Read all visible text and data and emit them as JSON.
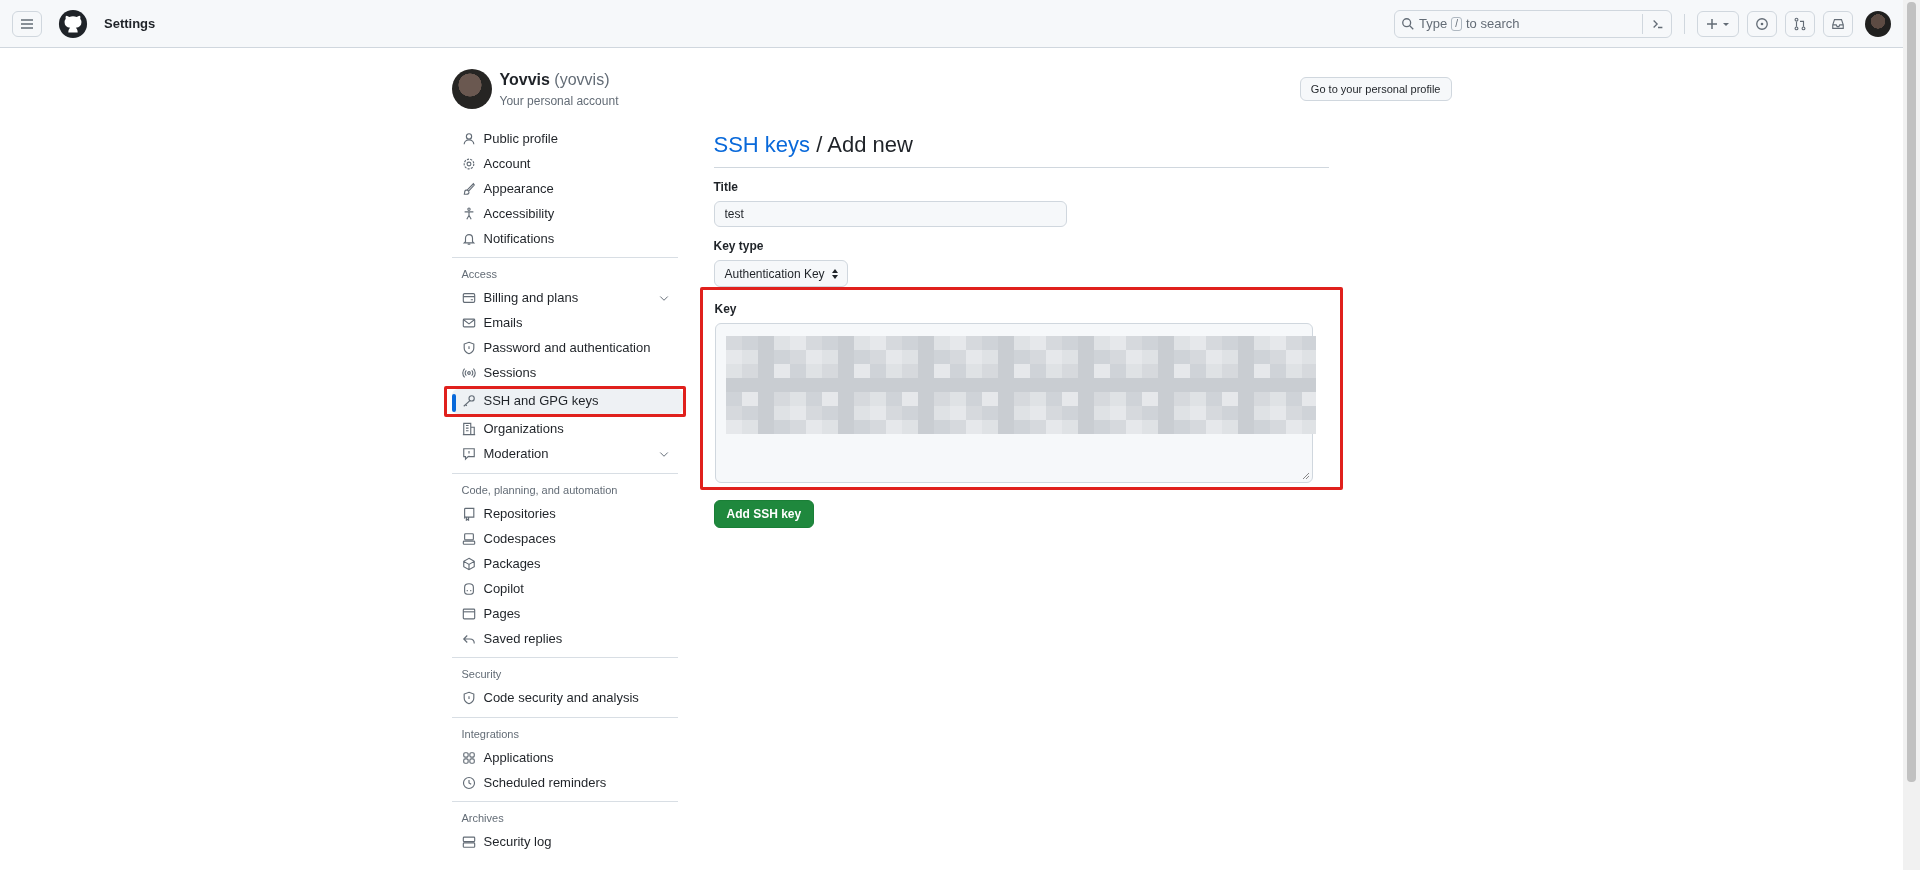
{
  "header": {
    "title": "Settings",
    "search": {
      "before": "Type",
      "key": "/",
      "after": "to search"
    }
  },
  "account": {
    "name": "Yovvis",
    "handle": "(yovvis)",
    "subtitle": "Your personal account",
    "profile_button": "Go to your personal profile"
  },
  "sidebar": {
    "sections": [
      {
        "items": [
          {
            "label": "Public profile",
            "selected": false,
            "expandable": false,
            "highlighted": false
          },
          {
            "label": "Account",
            "selected": false,
            "expandable": false,
            "highlighted": false
          },
          {
            "label": "Appearance",
            "selected": false,
            "expandable": false,
            "highlighted": false
          },
          {
            "label": "Accessibility",
            "selected": false,
            "expandable": false,
            "highlighted": false
          },
          {
            "label": "Notifications",
            "selected": false,
            "expandable": false,
            "highlighted": false
          }
        ]
      },
      {
        "heading": "Access",
        "items": [
          {
            "label": "Billing and plans",
            "selected": false,
            "expandable": true,
            "highlighted": false
          },
          {
            "label": "Emails",
            "selected": false,
            "expandable": false,
            "highlighted": false
          },
          {
            "label": "Password and authentication",
            "selected": false,
            "expandable": false,
            "highlighted": false
          },
          {
            "label": "Sessions",
            "selected": false,
            "expandable": false,
            "highlighted": false
          },
          {
            "label": "SSH and GPG keys",
            "selected": true,
            "expandable": false,
            "highlighted": true
          },
          {
            "label": "Organizations",
            "selected": false,
            "expandable": false,
            "highlighted": false
          },
          {
            "label": "Moderation",
            "selected": false,
            "expandable": true,
            "highlighted": false
          }
        ]
      },
      {
        "heading": "Code, planning, and automation",
        "items": [
          {
            "label": "Repositories",
            "selected": false,
            "expandable": false,
            "highlighted": false
          },
          {
            "label": "Codespaces",
            "selected": false,
            "expandable": false,
            "highlighted": false
          },
          {
            "label": "Packages",
            "selected": false,
            "expandable": false,
            "highlighted": false
          },
          {
            "label": "Copilot",
            "selected": false,
            "expandable": false,
            "highlighted": false
          },
          {
            "label": "Pages",
            "selected": false,
            "expandable": false,
            "highlighted": false
          },
          {
            "label": "Saved replies",
            "selected": false,
            "expandable": false,
            "highlighted": false
          }
        ]
      },
      {
        "heading": "Security",
        "items": [
          {
            "label": "Code security and analysis",
            "selected": false,
            "expandable": false,
            "highlighted": false
          }
        ]
      },
      {
        "heading": "Integrations",
        "items": [
          {
            "label": "Applications",
            "selected": false,
            "expandable": false,
            "highlighted": false
          },
          {
            "label": "Scheduled reminders",
            "selected": false,
            "expandable": false,
            "highlighted": false
          }
        ]
      },
      {
        "heading": "Archives",
        "items": [
          {
            "label": "Security log",
            "selected": false,
            "expandable": false,
            "highlighted": false
          }
        ]
      }
    ]
  },
  "main": {
    "breadcrumb": {
      "link": "SSH keys",
      "separator": "/",
      "current": "Add new"
    },
    "title_field": {
      "label": "Title",
      "value": "test"
    },
    "key_type_field": {
      "label": "Key type",
      "value": "Authentication Key"
    },
    "key_field": {
      "label": "Key",
      "highlighted": true
    },
    "submit_button": "Add SSH key"
  }
}
